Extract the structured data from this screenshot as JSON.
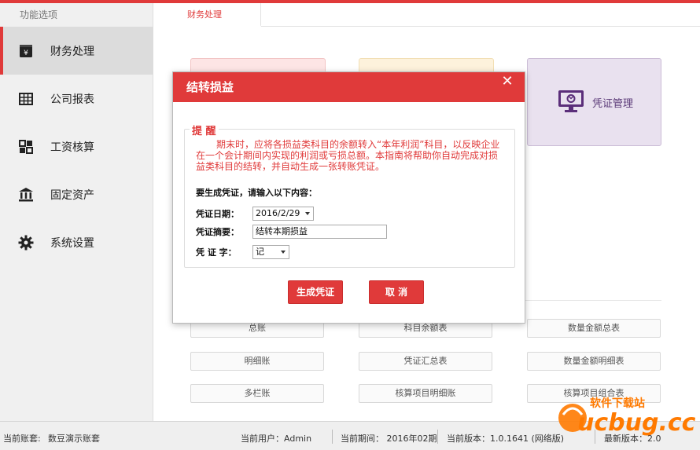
{
  "sidebar": {
    "header": "功能选项",
    "items": [
      {
        "label": "财务处理",
        "icon": "ledger-icon"
      },
      {
        "label": "公司报表",
        "icon": "table-icon"
      },
      {
        "label": "工资核算",
        "icon": "grid-icon"
      },
      {
        "label": "固定资产",
        "icon": "bank-icon"
      },
      {
        "label": "系统设置",
        "icon": "gear-icon"
      }
    ]
  },
  "tabs": [
    {
      "label": "财务处理"
    }
  ],
  "cards": {
    "voucher_management": {
      "label": "凭证管理",
      "icon": "monitor-icon"
    }
  },
  "grid_buttons": [
    [
      "总账",
      "科目余额表",
      "数量金额总表"
    ],
    [
      "明细账",
      "凭证汇总表",
      "数量金额明细表"
    ],
    [
      "多栏账",
      "核算项目明细账",
      "核算项目组合表"
    ]
  ],
  "dialog": {
    "title": "结转损益",
    "close_symbol": "✕",
    "legend": "提 醒",
    "notice": "期末时，应将各损益类科目的余额转入“本年利润”科目，以反映企业在一个会计期间内实现的利润或亏损总额。本指南将帮助你自动完成对损益类科目的结转，并自动生成一张转账凭证。",
    "prompt": "要生成凭证，请输入以下内容：",
    "fields": {
      "date": {
        "label": "凭证日期：",
        "value": "2016/2/29"
      },
      "summary": {
        "label": "凭证摘要：",
        "value": "结转本期损益"
      },
      "word": {
        "label": "凭 证 字：",
        "value": "记"
      }
    },
    "generate_button": "生成凭证",
    "cancel_button": "取 消"
  },
  "status": {
    "account_label": "当前账套:",
    "account_value": "数豆演示账套",
    "user": "当前用户：Admin",
    "period": "当前期间：  2016年02期",
    "version": "当前版本：1.0.1641  (网络版)",
    "latest": "最新版本：2.0"
  },
  "watermark": {
    "text": "ucbug.cc",
    "subtitle": "软件下载站"
  },
  "colors": {
    "accent": "#e03a3a",
    "purple_card": "#e9e1ef",
    "pink_card": "#fde5e5",
    "yellow_card": "#fdf2dc"
  }
}
